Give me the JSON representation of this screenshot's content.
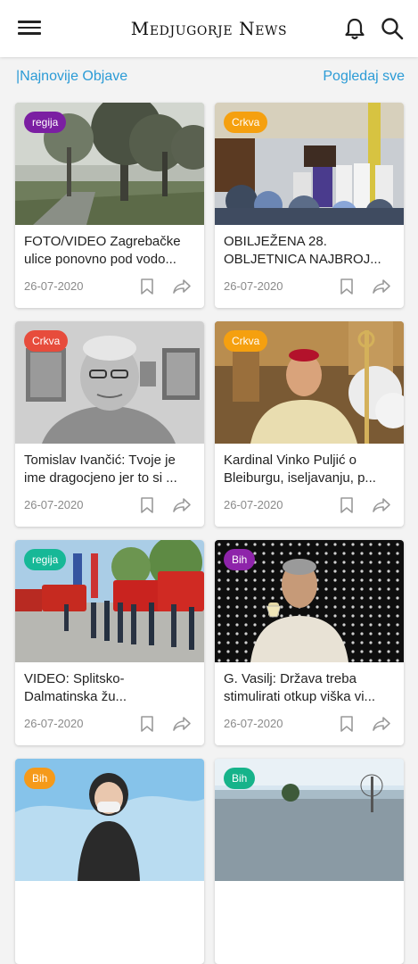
{
  "app": {
    "title": "Medjugorje News"
  },
  "section": {
    "title": "|Najnovije Objave",
    "see_all": "Pogledaj sve"
  },
  "colors": {
    "accent": "#2b9bd6",
    "regija": "#7b1fa2",
    "crkva_orange": "#f5a00f",
    "crkva_red": "#e74c3c",
    "regija_teal": "#17b897",
    "bih_purple": "#8e24aa",
    "bih_orange": "#f59a1a",
    "bih_teal": "#16b38a"
  },
  "icons": {
    "menu": "menu-icon",
    "bell": "bell-icon",
    "search": "search-icon",
    "bookmark": "bookmark-icon",
    "share": "share-icon"
  },
  "cards": [
    {
      "badge": "regija",
      "title": "FOTO/VIDEO Zagrebačke ulice ponovno pod vodo...",
      "date": "26-07-2020"
    },
    {
      "badge": "Crkva",
      "title": "OBILJEŽENA 28. OBLJETNICA NAJBROJ...",
      "date": "26-07-2020"
    },
    {
      "badge": "Crkva",
      "title": "Tomislav Ivančić: Tvoje je ime dragocjeno jer to si ...",
      "date": "26-07-2020"
    },
    {
      "badge": "Crkva",
      "title": "Kardinal Vinko Puljić o Bleiburgu, iseljavanju, p...",
      "date": "26-07-2020"
    },
    {
      "badge": "regija",
      "title": "VIDEO: Splitsko-Dalmatinska žu...",
      "date": "26-07-2020"
    },
    {
      "badge": "Bih",
      "title": "G. Vasilj: Država treba stimulirati otkup viška vi...",
      "date": "26-07-2020"
    },
    {
      "badge": "Bih",
      "title": "",
      "date": ""
    },
    {
      "badge": "Bih",
      "title": "",
      "date": ""
    }
  ]
}
